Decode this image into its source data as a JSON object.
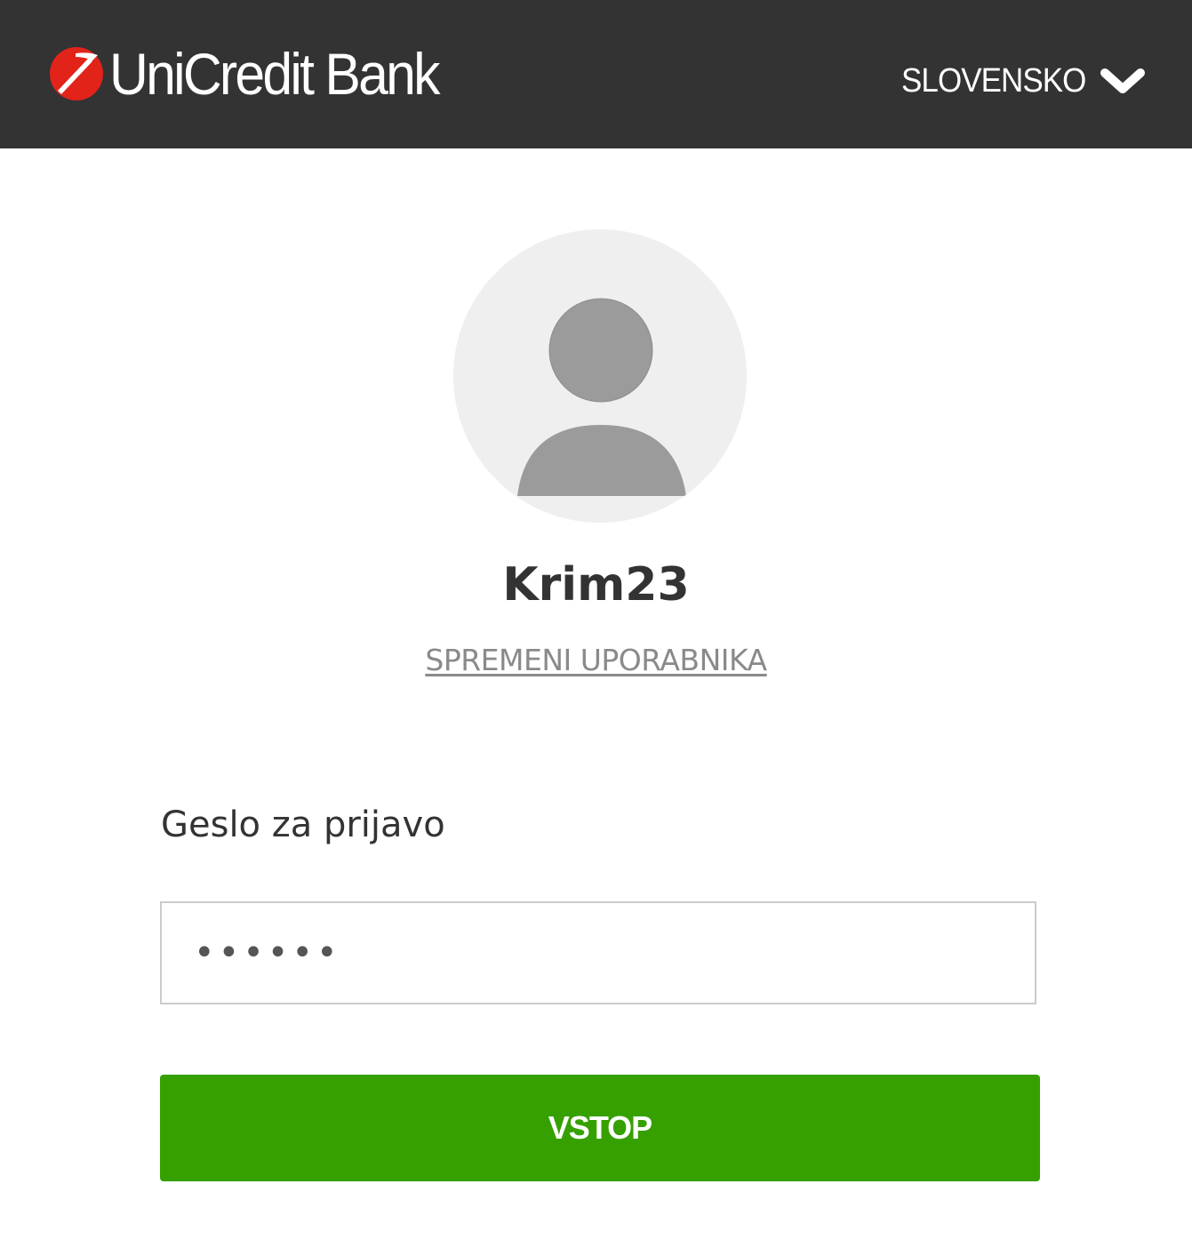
{
  "header": {
    "brand_name": "UniCredit Bank",
    "language_label": "SLOVENSKO",
    "language_icon": "chevron-down-icon",
    "background_color": "#333333"
  },
  "profile": {
    "avatar_icon": "user-avatar-icon",
    "username": "Krim23",
    "change_user_label": "SPREMENI UPORABNIKA"
  },
  "login_form": {
    "password_label": "Geslo za prijavo",
    "password_value": "••••••",
    "submit_label": "VSTOP",
    "submit_color": "#35a000"
  },
  "colors": {
    "brand_red": "#e2231a",
    "text_dark": "#333333",
    "link_gray": "#8a8a8a"
  }
}
